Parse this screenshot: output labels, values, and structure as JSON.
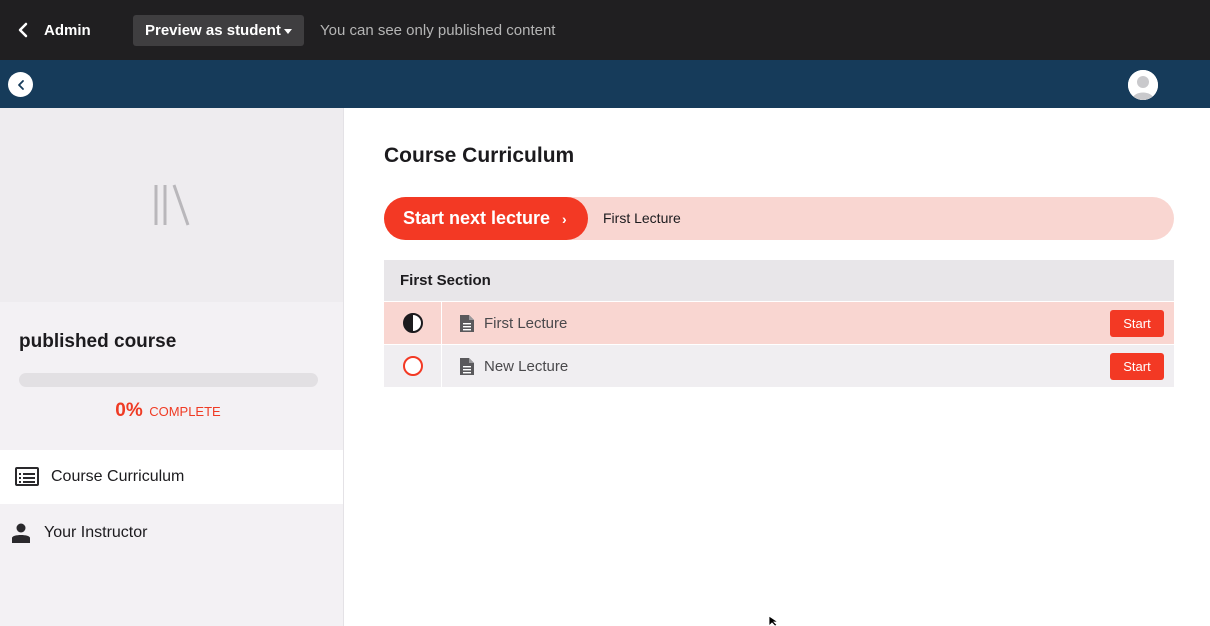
{
  "admin_bar": {
    "back_label": "Admin",
    "preview_label": "Preview as student",
    "note": "You can see only published content"
  },
  "sidebar": {
    "course_name": "published course",
    "progress": {
      "percent_label": "0%",
      "complete_label": "COMPLETE",
      "fraction": 0
    },
    "nav": [
      {
        "label": "Course Curriculum",
        "icon": "list-icon",
        "active": true
      },
      {
        "label": "Your Instructor",
        "icon": "person-icon",
        "active": false
      }
    ]
  },
  "main": {
    "title": "Course Curriculum",
    "next_lecture": {
      "button_label": "Start next lecture",
      "lecture_name": "First Lecture"
    },
    "section": {
      "title": "First Section",
      "lectures": [
        {
          "name": "First Lecture",
          "status": "in-progress",
          "button": "Start"
        },
        {
          "name": "New Lecture",
          "status": "not-started",
          "button": "Start"
        }
      ]
    }
  },
  "colors": {
    "accent": "#f33924",
    "admin_bar_bg": "#201f21",
    "course_bar_bg": "#163b5a",
    "highlight_row": "#f9d6d1"
  }
}
